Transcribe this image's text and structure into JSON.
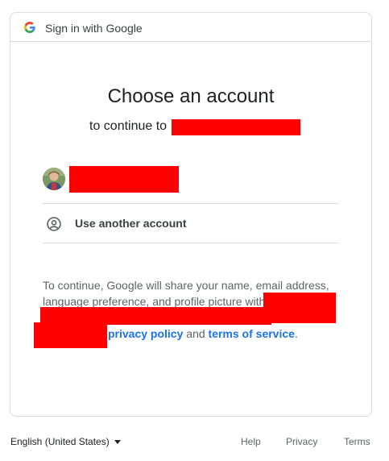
{
  "header": {
    "title": "Sign in with Google",
    "logo_icon": "google-g-icon"
  },
  "main": {
    "title": "Choose an account",
    "subtitle_prefix": "to continue to",
    "accounts": [
      {
        "avatar_icon": "user-avatar"
      }
    ],
    "use_another_label": "Use another account",
    "use_another_icon": "account-circle-icon",
    "disclaimer": {
      "line1": "To continue, Google will share your name, email address,",
      "line2": "language preference, and profile picture with",
      "privacy_policy": "privacy policy",
      "and": "and",
      "terms_of_service": "terms of service",
      "period": "."
    }
  },
  "footer": {
    "language": "English (United States)",
    "help": "Help",
    "privacy": "Privacy",
    "terms": "Terms"
  },
  "colors": {
    "link": "#1a73e8",
    "redaction": "#ff0000",
    "border": "#dadce0"
  }
}
